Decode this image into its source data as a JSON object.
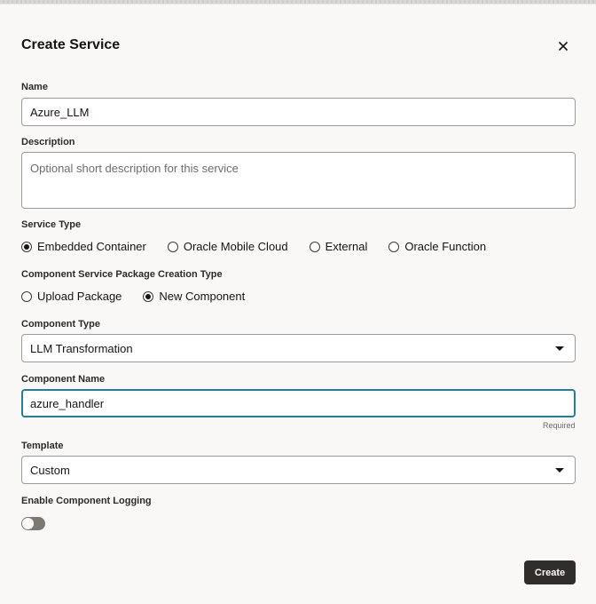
{
  "dialog": {
    "title": "Create Service",
    "close_icon": "close-icon"
  },
  "name": {
    "label": "Name",
    "value": "Azure_LLM"
  },
  "description": {
    "label": "Description",
    "placeholder": "Optional short description for this service",
    "value": ""
  },
  "service_type": {
    "label": "Service Type",
    "options": [
      "Embedded Container",
      "Oracle Mobile Cloud",
      "External",
      "Oracle Function"
    ],
    "selected": "Embedded Container"
  },
  "package_creation": {
    "label": "Component Service Package Creation Type",
    "options": [
      "Upload Package",
      "New Component"
    ],
    "selected": "New Component"
  },
  "component_type": {
    "label": "Component Type",
    "value": "LLM Transformation"
  },
  "component_name": {
    "label": "Component Name",
    "value": "azure_handler",
    "helper": "Required"
  },
  "template": {
    "label": "Template",
    "value": "Custom"
  },
  "logging": {
    "label": "Enable Component Logging",
    "enabled": false
  },
  "footer": {
    "create_label": "Create"
  },
  "colors": {
    "accent_focus": "#227e9e",
    "primary_button": "#312d2a",
    "background": "#f9f8f6"
  }
}
